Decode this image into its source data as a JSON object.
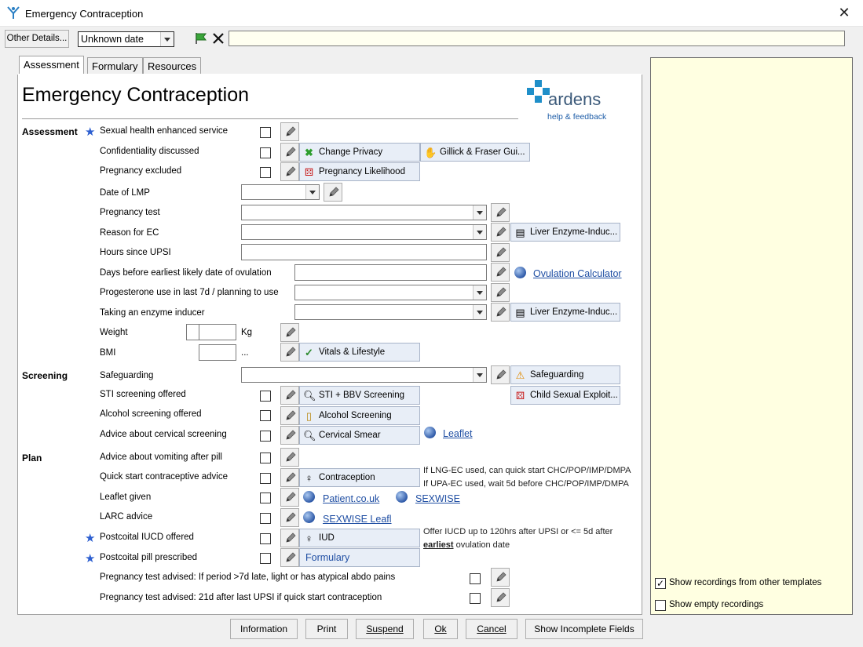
{
  "window": {
    "title": "Emergency Contraception",
    "close_glyph": "✕"
  },
  "toolbar": {
    "other_details": "Other Details...",
    "date_value": "Unknown date"
  },
  "tabs": [
    "Assessment",
    "Formulary",
    "Resources"
  ],
  "page_title": "Emergency Contraception",
  "brand": {
    "name": "ardens",
    "tagline": "help & feedback"
  },
  "sections": {
    "assessment": "Assessment",
    "screening": "Screening",
    "plan": "Plan"
  },
  "rows": {
    "r1": "Sexual health enhanced service",
    "r2": "Confidentiality discussed",
    "r3": "Pregnancy excluded",
    "r4": "Date of LMP",
    "r5": "Pregnancy test",
    "r6": "Reason for EC",
    "r7": "Hours since UPSI",
    "r8": "Days before earliest likely date of ovulation",
    "r9": "Progesterone use in last 7d / planning to use",
    "r10": "Taking an enzyme inducer",
    "r11": "Weight",
    "r11_unit": "Kg",
    "r12": "BMI",
    "r12_unit": "...",
    "r13": "Safeguarding",
    "r14": "STI screening offered",
    "r15": "Alcohol screening offered",
    "r16": "Advice about cervical screening",
    "r17": "Advice about vomiting after pill",
    "r18": "Quick start contraceptive advice",
    "r19": "Leaflet given",
    "r20": "LARC advice",
    "r21": "Postcoital IUCD offered",
    "r22": "Postcoital pill prescribed",
    "r23": "Pregnancy test advised: If period >7d late, light or has atypical abdo pains",
    "r24": "Pregnancy test advised: 21d after last UPSI if quick start contraception"
  },
  "actions": {
    "change_privacy": "Change Privacy",
    "gillick": "Gillick & Fraser Gui...",
    "preg_likelihood": "Pregnancy Likelihood",
    "liver1": "Liver Enzyme-Induc...",
    "liver2": "Liver Enzyme-Induc...",
    "vitals": "Vitals & Lifestyle",
    "safeguarding": "Safeguarding",
    "cse": "Child Sexual Exploit...",
    "sti": "STI + BBV Screening",
    "alcohol": "Alcohol Screening",
    "cervical": "Cervical Smear",
    "contraception": "Contraception",
    "iud": "IUD",
    "formulary": "Formulary"
  },
  "links": {
    "ovulation": "Ovulation Calculator",
    "leaflet": "Leaflet",
    "patient": "Patient.co.uk",
    "sexwise": "SEXWISE",
    "sexwise_leafl": "SEXWISE Leafl"
  },
  "notes": {
    "lng": "If LNG-EC used, can quick start CHC/POP/IMP/DMPA",
    "upa": "If UPA-EC used, wait 5d before CHC/POP/IMP/DMPA",
    "iucd1": "Offer IUCD up to 120hrs after UPSI or <= 5d after",
    "iucd2_bold": "earliest",
    "iucd2_rest": " ovulation date"
  },
  "right_panel": {
    "show_other": "Show recordings from other templates",
    "show_other_checked": true,
    "show_empty": "Show empty recordings",
    "show_empty_checked": false
  },
  "footer": [
    "Information",
    "Print",
    "Suspend",
    "Ok",
    "Cancel",
    "Show Incomplete Fields"
  ],
  "colors": {
    "accent": "#1f8fc9",
    "link": "#1f4ea3",
    "right_panel_bg": "#ffffe1"
  }
}
